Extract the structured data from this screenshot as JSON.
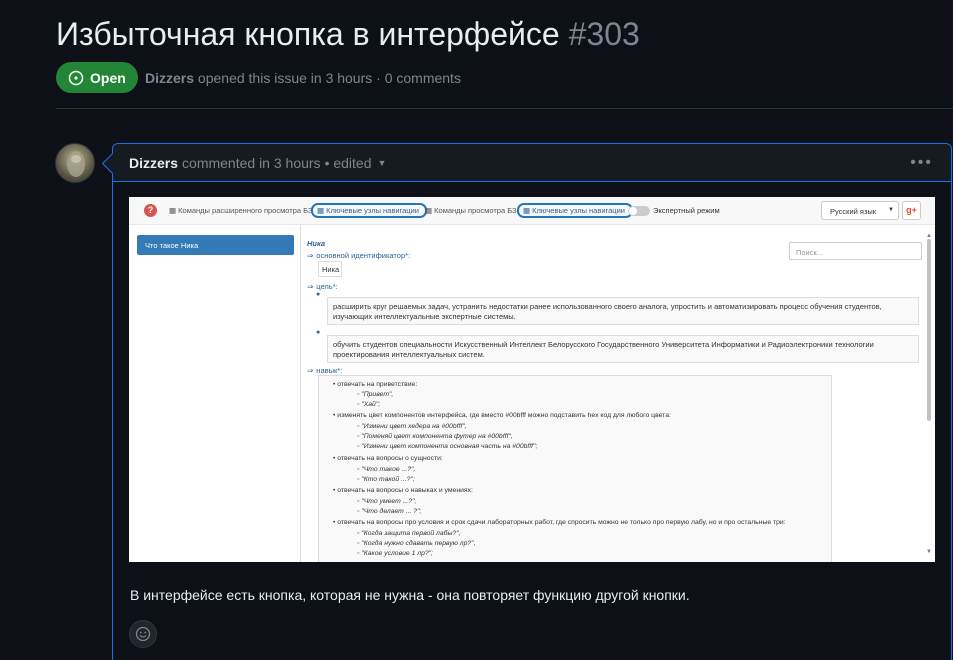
{
  "issue": {
    "title": "Избыточная кнопка в интерфейсе",
    "number": "#303",
    "state": "Open",
    "author": "Dizzers",
    "meta_text": "opened this issue in 3 hours · 0 comments"
  },
  "comment": {
    "author": "Dizzers",
    "meta": "commented in 3 hours",
    "edited": "• edited",
    "body": "В интерфейсе есть кнопка, которая не нужна - она повторяет функцию другой кнопки."
  },
  "screenshot": {
    "nav": {
      "help": "?",
      "cmd1": "Команды расширенного просмотра БЗ",
      "nodes1": "Ключевые узлы навигации",
      "cmd2": "Команды просмотра БЗ",
      "nodes2": "Ключевые узлы навигации",
      "expert": "Экспертный режим",
      "lang": "Русский язык",
      "gplus": "g+"
    },
    "sidebar_item": "Что такое Ника",
    "search_placeholder": "Поиск...",
    "entity_title": "Ника",
    "rel_id": "основной идентификатор*:",
    "id_value": "Ника",
    "rel_goal": "цель*:",
    "goal1": "расширить круг решаемых задач, устранить недостатки ранее использованного своего аналога, упростить и автоматизировать процесс обучения студентов, изучающих интеллектуальные экспертные системы.",
    "goal2": "обучить студентов специальности Искусственный Интеллект Белорусского Государственного Университета Информатики и Радиоэлектроники технологии проектирования интеллектуальных систем.",
    "rel_skill": "навык*:",
    "skills": [
      {
        "text": "отвечать на приветствие:",
        "sub": [
          "\"Привет\",",
          "\"Хай\";"
        ]
      },
      {
        "text": "изменять цвет компонентов интерфейса, где вместо #00bfff можно подставить hex код для любого цвета:",
        "sub": [
          "\"Измени цвет хедера на #00bfff\",",
          "\"Поменяй цвет компонента футер на #00bfff\",",
          "\"Измени цвет компонента основная часть на #00bfff\";"
        ]
      },
      {
        "text": "отвечать на вопросы о сущности:",
        "sub": [
          "\"Что такое ...?\",",
          "\"Кто такой ...?\";"
        ]
      },
      {
        "text": "отвечать на вопросы о навыках и умениях:",
        "sub": [
          "\"Что умеет ...?\",",
          "\"Что делает ... ?\";"
        ]
      },
      {
        "text": "отвечать на вопросы про условия и срок сдачи лабораторных работ, где спросить можно не только про первую лабу, но и про остальные три:",
        "sub": [
          "\"Когда защита первой лабы?\",",
          "\"Когда нужно сдавать первую лр?\",",
          "\"Какое условие 1 лр?\";"
        ]
      }
    ]
  },
  "colors": {
    "accent": "#1f6feb",
    "open": "#238636",
    "bg": "#0d1117"
  }
}
